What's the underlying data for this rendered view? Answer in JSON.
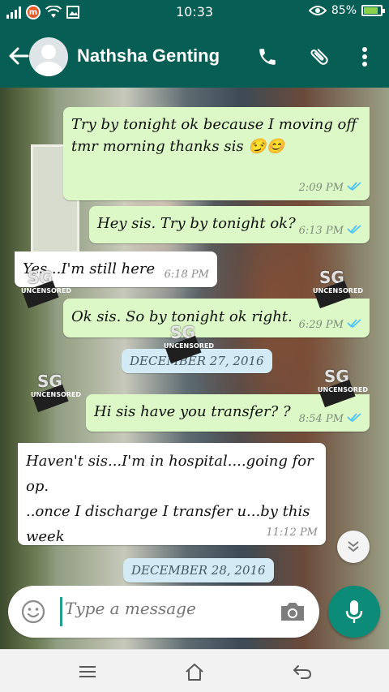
{
  "status_bar": {
    "time": "10:33",
    "carrier_badge": "m",
    "battery_percent": "85%",
    "battery_level": 0.85,
    "icons": [
      "signal-icon",
      "carrier-icon",
      "wifi-icon",
      "image-icon",
      "eye-icon",
      "battery-icon"
    ]
  },
  "header": {
    "contact_name": "Nathsha Genting",
    "icons": [
      "back-arrow-icon",
      "avatar-icon",
      "phone-icon",
      "attachment-icon",
      "more-vertical-icon"
    ]
  },
  "messages": [
    {
      "direction": "out",
      "lines": [
        "Try by tonight ok because I moving off",
        "tmr morning thanks sis 😏😊"
      ],
      "time": "2:09 PM",
      "read": true
    },
    {
      "direction": "out",
      "lines": [
        "Hey sis. Try by tonight ok?"
      ],
      "time": "6:13 PM",
      "read": true
    },
    {
      "direction": "in",
      "lines": [
        "Yes...I'm still here"
      ],
      "time": "6:18 PM"
    },
    {
      "direction": "out",
      "lines": [
        "Ok sis. So by tonight ok right."
      ],
      "time": "6:29 PM",
      "read": true
    },
    {
      "direction": "date",
      "label": "DECEMBER 27, 2016"
    },
    {
      "direction": "out",
      "lines": [
        "Hi sis have you transfer? ?"
      ],
      "time": "8:54 PM",
      "read": true
    },
    {
      "direction": "in",
      "lines": [
        "Haven't sis...I'm in hospital....going for op.",
        "..once I discharge I transfer u...by this",
        "week"
      ],
      "time": "11:12 PM"
    },
    {
      "direction": "date",
      "label": "DECEMBER 28, 2016"
    }
  ],
  "watermark": {
    "logo": "SG",
    "text": "UNCENSORED"
  },
  "composer": {
    "placeholder": "Type a message",
    "icons": [
      "emoji-icon",
      "camera-icon",
      "mic-icon",
      "scroll-down-icon"
    ]
  },
  "navbar": {
    "icons": [
      "menu-icon",
      "home-icon",
      "back-icon"
    ]
  },
  "colors": {
    "header": "#075e54",
    "outgoing": "#dcf8c6",
    "incoming": "#ffffff",
    "tick_blue": "#4fc3f7",
    "mic": "#0b8b78"
  }
}
